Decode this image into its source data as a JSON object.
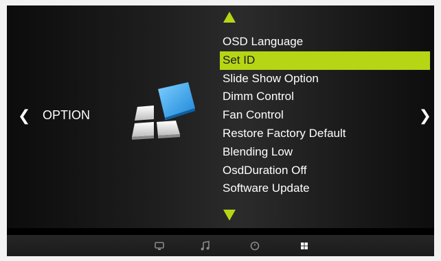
{
  "header": {
    "category_label": "OPTION"
  },
  "icons": {
    "left_nav": "chevron-left-icon",
    "right_nav": "chevron-right-icon",
    "scroll_up": "triangle-up-icon",
    "scroll_down": "triangle-down-icon",
    "category": "option-tiles-icon"
  },
  "menu": {
    "items": [
      {
        "label": "OSD Language",
        "selected": false
      },
      {
        "label": "Set ID",
        "selected": true
      },
      {
        "label": "Slide Show Option",
        "selected": false
      },
      {
        "label": "Dimm Control",
        "selected": false
      },
      {
        "label": "Fan Control",
        "selected": false
      },
      {
        "label": "Restore Factory Default",
        "selected": false
      },
      {
        "label": "Blending Low",
        "selected": false
      },
      {
        "label": "OsdDuration Off",
        "selected": false
      },
      {
        "label": "Software Update",
        "selected": false
      }
    ]
  },
  "bottom_tabs": [
    {
      "icon": "picture-icon",
      "active": false
    },
    {
      "icon": "music-note-icon",
      "active": false
    },
    {
      "icon": "clock-icon",
      "active": false
    },
    {
      "icon": "option-grid-icon",
      "active": true
    }
  ],
  "colors": {
    "accent": "#b6d615",
    "background": "#000000",
    "text": "#ffffff"
  }
}
